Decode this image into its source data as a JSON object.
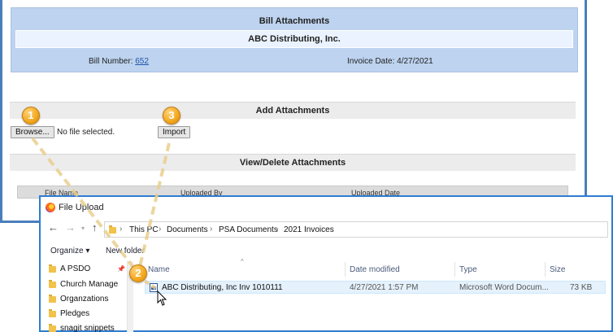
{
  "web_page": {
    "title": "Bill Attachments",
    "vendor": "ABC Distributing, Inc.",
    "bill_number_label": "Bill Number:",
    "bill_number": "652",
    "invoice_date_label": "Invoice Date:",
    "invoice_date": "4/27/2021",
    "add_section": "Add Attachments",
    "browse_label": "Browse...",
    "no_file_text": "No file selected.",
    "import_label": "Import",
    "view_section": "View/Delete Attachments",
    "columns": [
      "File Name",
      "Uploaded By",
      "Uploaded Date"
    ]
  },
  "dialog": {
    "title": "File Upload",
    "breadcrumb": [
      "This PC",
      "Documents",
      "PSA Documents",
      "2021 Invoices"
    ],
    "organize_label": "Organize",
    "new_folder_label": "New folder",
    "nav_items": [
      "A PSDO",
      "Church Manage",
      "Organzations",
      "Pledges",
      "snagit snippets"
    ],
    "columns": [
      "Name",
      "Date modified",
      "Type",
      "Size"
    ],
    "file": {
      "name": "ABC Distributing, Inc Inv 1010111",
      "date_modified": "4/27/2021 1:57 PM",
      "type": "Microsoft Word Docum...",
      "size": "73 KB"
    }
  },
  "callouts": [
    "1",
    "2",
    "3"
  ],
  "colors": {
    "header_blue": "#bdd3ef",
    "frame_blue": "#4a7ebb",
    "callout_orange": "#f2a71b",
    "selection": "#e5f1fb"
  },
  "icons": [
    "firefox-icon",
    "back-arrow-icon",
    "forward-arrow-icon",
    "up-arrow-icon",
    "folder-icon",
    "pin-icon",
    "word-document-icon",
    "mouse-cursor-icon"
  ]
}
